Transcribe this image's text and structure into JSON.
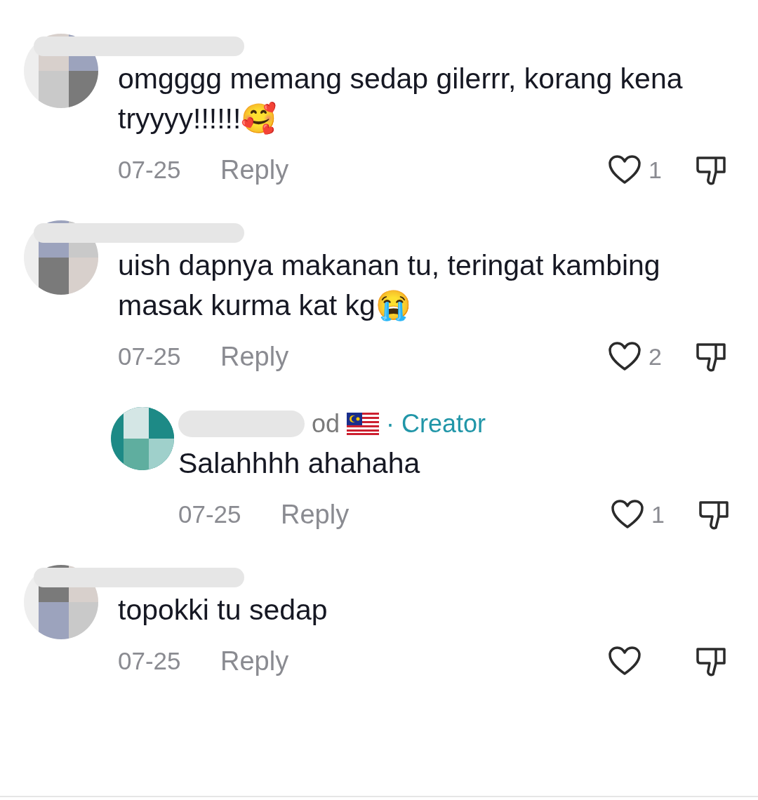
{
  "comments": [
    {
      "kind": "comment",
      "text": "omgggg memang sedap gilerrr, korang kena tryyyy!!!!!!🥰",
      "date": "07-25",
      "reply": "Reply",
      "likes": "1"
    },
    {
      "kind": "comment",
      "text": "uish dapnya makanan tu, teringat kambing masak kurma kat kg😭",
      "date": "07-25",
      "reply": "Reply",
      "likes": "2"
    },
    {
      "kind": "reply",
      "name_end": "od",
      "badge": "· Creator",
      "text": "Salahhhh ahahaha",
      "date": "07-25",
      "reply": "Reply",
      "likes": "1"
    },
    {
      "kind": "comment",
      "text": "topokki tu sedap",
      "date": "07-25",
      "reply": "Reply"
    }
  ]
}
